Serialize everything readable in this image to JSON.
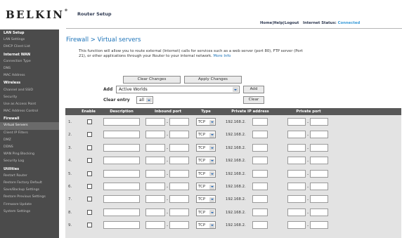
{
  "header": {
    "logo": "BELKIN",
    "logo_mark": "®",
    "router_setup": "Router Setup",
    "home": "Home",
    "help": "Help",
    "logout": "Logout",
    "sep": "|",
    "internet_status_label": "Internet Status:",
    "internet_status_value": "Connected"
  },
  "sidebar": {
    "items": [
      {
        "label": "LAN Setup",
        "type": "head"
      },
      {
        "label": "LAN Settings",
        "type": "item"
      },
      {
        "label": "DHCP Client List",
        "type": "item"
      },
      {
        "label": "Internet WAN",
        "type": "head"
      },
      {
        "label": "Connection Type",
        "type": "item"
      },
      {
        "label": "DNS",
        "type": "item"
      },
      {
        "label": "MAC Address",
        "type": "item"
      },
      {
        "label": "Wireless",
        "type": "head"
      },
      {
        "label": "Channel and SSID",
        "type": "item"
      },
      {
        "label": "Security",
        "type": "item"
      },
      {
        "label": "Use as Access Point",
        "type": "item"
      },
      {
        "label": "MAC Address Control",
        "type": "item"
      },
      {
        "label": "Firewall",
        "type": "head"
      },
      {
        "label": "Virtual Servers",
        "type": "active"
      },
      {
        "label": "Client IP Filters",
        "type": "item"
      },
      {
        "label": "DMZ",
        "type": "item"
      },
      {
        "label": "DDNS",
        "type": "item"
      },
      {
        "label": "WAN Ping Blocking",
        "type": "item"
      },
      {
        "label": "Security Log",
        "type": "item"
      },
      {
        "label": "Utilities",
        "type": "head"
      },
      {
        "label": "Restart Router",
        "type": "item"
      },
      {
        "label": "Restore Factory Default",
        "type": "item"
      },
      {
        "label": "Save/Backup Settings",
        "type": "item"
      },
      {
        "label": "Restore Previous Settings",
        "type": "item"
      },
      {
        "label": "Firmware Update",
        "type": "item"
      },
      {
        "label": "System Settings",
        "type": "item"
      }
    ]
  },
  "main": {
    "title": "Firewall > Virtual servers",
    "description": "This function will allow you to route external (Internet) calls for services such as a web server (port 80), FTP server (Port 21), or other applications through your Router to your internal network.",
    "more_info": "More Info",
    "clear_changes": "Clear Changes",
    "apply_changes": "Apply Changes",
    "add_label": "Add",
    "add_select_value": "Active Worlds",
    "add_button": "Add",
    "clear_entry_label": "Clear entry",
    "clear_select_value": "all",
    "clear_button": "Clear"
  },
  "table": {
    "headers": [
      "Enable",
      "Description",
      "Inbound port",
      "Type",
      "Private IP address",
      "Private port"
    ],
    "rows": [
      {
        "num": "1.",
        "type": "TCP",
        "ip_prefix": "192.168.2."
      },
      {
        "num": "2.",
        "type": "TCP",
        "ip_prefix": "192.168.2."
      },
      {
        "num": "3.",
        "type": "TCP",
        "ip_prefix": "192.168.2."
      },
      {
        "num": "4.",
        "type": "TCP",
        "ip_prefix": "192.168.2."
      },
      {
        "num": "5.",
        "type": "TCP",
        "ip_prefix": "192.168.2."
      },
      {
        "num": "6.",
        "type": "TCP",
        "ip_prefix": "192.168.2."
      },
      {
        "num": "7.",
        "type": "TCP",
        "ip_prefix": "192.168.2."
      },
      {
        "num": "8.",
        "type": "TCP",
        "ip_prefix": "192.168.2."
      },
      {
        "num": "9.",
        "type": "TCP",
        "ip_prefix": "192.168.2."
      }
    ]
  },
  "colors": {
    "accent": "#1b72b8",
    "sidebar": "#4b4b4b",
    "table_header": "#585858",
    "table_body": "#e3e3e3",
    "connected": "#3a9bd8"
  }
}
